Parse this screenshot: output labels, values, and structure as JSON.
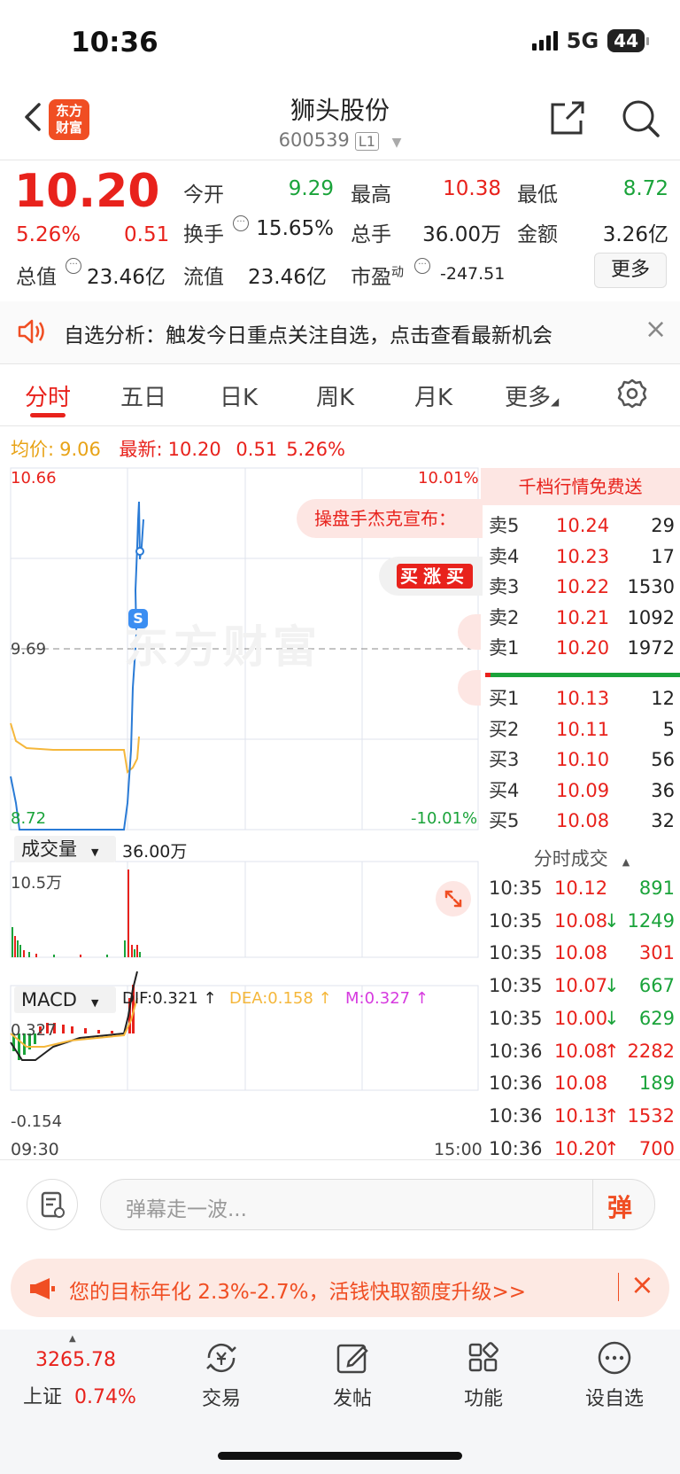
{
  "status": {
    "time": "10:36",
    "network": "5G",
    "battery": "44"
  },
  "header": {
    "logo_text_1": "东方",
    "logo_text_2": "财富",
    "stock_name": "狮头股份",
    "stock_code": "600539",
    "level": "L1"
  },
  "quote": {
    "price": "10.20",
    "change_pct": "5.26%",
    "change_amt": "0.51",
    "rows": [
      [
        {
          "label": "今开",
          "value": "9.29",
          "color": "green"
        },
        {
          "label": "最高",
          "value": "10.38",
          "color": "red"
        },
        {
          "label": "最低",
          "value": "8.72",
          "color": "green"
        }
      ],
      [
        {
          "label": "换手",
          "value": "15.65%",
          "color": "dark"
        },
        {
          "label": "总手",
          "value": "36.00万",
          "color": "dark"
        },
        {
          "label": "金额",
          "value": "3.26亿",
          "color": "dark"
        }
      ]
    ],
    "total_value_label": "总值",
    "total_value": "23.46亿",
    "float_value_label": "流值",
    "float_value": "23.46亿",
    "pe_label": "市盈",
    "pe_sup": "动",
    "pe_value": "-247.51",
    "more_label": "更多"
  },
  "notice": {
    "text": "自选分析：触发今日重点关注自选，点击查看最新机会",
    "close": "×"
  },
  "tabs": [
    "分时",
    "五日",
    "日K",
    "周K",
    "月K",
    "更多"
  ],
  "summary": {
    "avg_label": "均价:",
    "avg_value": "9.06",
    "latest_label": "最新:",
    "latest_price": "10.20",
    "latest_change": "0.51",
    "latest_pct": "5.26%"
  },
  "chart": {
    "top_price": "10.66",
    "top_pct": "10.01%",
    "bottom_price": "8.72",
    "bottom_pct": "-10.01%",
    "mid_price": "9.69",
    "watermark": "东方财富",
    "banner": "操盘手杰克宣布：",
    "badge_text": "买涨买",
    "s_marker": "S",
    "volume_label": "成交量",
    "volume_value": "36.00万",
    "volume_max": "10.5万",
    "macd_label": "MACD",
    "dif": "DIF:0.321 ↑",
    "dea": "DEA:0.158 ↑",
    "m": "M:0.327 ↑",
    "macd_top": "0.327",
    "macd_bottom": "-0.154",
    "time_start": "09:30",
    "time_end": "15:00"
  },
  "chart_data": {
    "type": "line",
    "title": "",
    "x": [
      "09:30",
      "10:36"
    ],
    "ylim": [
      8.72,
      10.66
    ],
    "series": [
      {
        "name": "均价",
        "values": [
          9.06
        ]
      },
      {
        "name": "最新",
        "values": [
          10.2
        ]
      }
    ]
  },
  "orderbook": {
    "header": "千档行情免费送",
    "asks": [
      {
        "label": "卖5",
        "price": "10.24",
        "vol": "29"
      },
      {
        "label": "卖4",
        "price": "10.23",
        "vol": "17"
      },
      {
        "label": "卖3",
        "price": "10.22",
        "vol": "1530"
      },
      {
        "label": "卖2",
        "price": "10.21",
        "vol": "1092"
      },
      {
        "label": "卖1",
        "price": "10.20",
        "vol": "1972"
      }
    ],
    "bids": [
      {
        "label": "买1",
        "price": "10.13",
        "vol": "12"
      },
      {
        "label": "买2",
        "price": "10.11",
        "vol": "5"
      },
      {
        "label": "买3",
        "price": "10.10",
        "vol": "56"
      },
      {
        "label": "买4",
        "price": "10.09",
        "vol": "36"
      },
      {
        "label": "买5",
        "price": "10.08",
        "vol": "32"
      }
    ],
    "ticks_header": "分时成交",
    "ticks": [
      {
        "time": "10:35",
        "price": "10.12",
        "arrow": "",
        "vol": "891",
        "vcolor": "green"
      },
      {
        "time": "10:35",
        "price": "10.08",
        "arrow": "↓",
        "vol": "1249",
        "vcolor": "green"
      },
      {
        "time": "10:35",
        "price": "10.08",
        "arrow": "",
        "vol": "301",
        "vcolor": "red"
      },
      {
        "time": "10:35",
        "price": "10.07",
        "arrow": "↓",
        "vol": "667",
        "vcolor": "green"
      },
      {
        "time": "10:35",
        "price": "10.00",
        "arrow": "↓",
        "vol": "629",
        "vcolor": "green"
      },
      {
        "time": "10:36",
        "price": "10.08",
        "arrow": "↑",
        "vol": "2282",
        "vcolor": "red"
      },
      {
        "time": "10:36",
        "price": "10.08",
        "arrow": "",
        "vol": "189",
        "vcolor": "green"
      },
      {
        "time": "10:36",
        "price": "10.13",
        "arrow": "↑",
        "vol": "1532",
        "vcolor": "red"
      },
      {
        "time": "10:36",
        "price": "10.20",
        "arrow": "↑",
        "vol": "700",
        "vcolor": "red"
      }
    ]
  },
  "comment": {
    "placeholder": "弹幕走一波...",
    "danmu_btn": "弹"
  },
  "promo": {
    "text": "您的目标年化 2.3%-2.7%，活钱快取额度升级>>",
    "close": "×"
  },
  "bottom_nav": {
    "index_value": "3265.78",
    "index_name": "上证",
    "index_pct": "0.74%",
    "items": [
      "交易",
      "发帖",
      "功能",
      "设自选"
    ]
  }
}
